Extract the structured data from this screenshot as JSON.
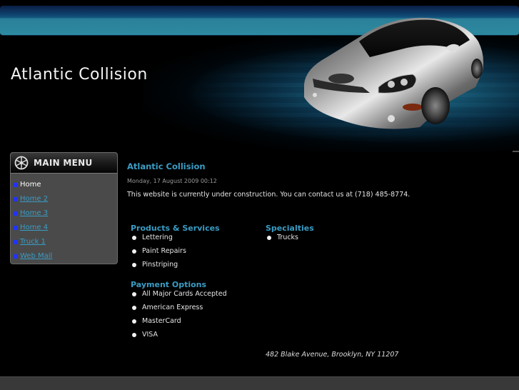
{
  "header": {
    "site_title": "Atlantic Collision",
    "banner_image": "silver-sports-car"
  },
  "menu": {
    "title": "MAIN MENU",
    "icon": "wheel-icon",
    "items": [
      {
        "label": "Home",
        "current": true
      },
      {
        "label": "Home 2",
        "current": false
      },
      {
        "label": "Home 3",
        "current": false
      },
      {
        "label": "Home 4",
        "current": false
      },
      {
        "label": "Truck 1",
        "current": false
      },
      {
        "label": "Web Mail",
        "current": false
      }
    ]
  },
  "article": {
    "title": "Atlantic Collision",
    "date": "Monday, 17 August 2009 00:12",
    "body": "This website is currently under construction. You can contact us at (718) 485-8774."
  },
  "sections": {
    "products": {
      "heading": "Products & Services",
      "items": [
        "Lettering",
        "Paint Repairs",
        "Pinstriping"
      ]
    },
    "specialties": {
      "heading": "Specialties",
      "items": [
        "Trucks"
      ]
    },
    "payment": {
      "heading": "Payment Options",
      "items": [
        "All Major Cards Accepted",
        "American Express",
        "MasterCard",
        "VISA"
      ]
    }
  },
  "address": "482 Blake Avenue, Brooklyn, NY 11207",
  "colors": {
    "accent": "#3a9cc4",
    "menu_bullet": "#2233ff",
    "background": "#000000",
    "menu_bg": "#4a4a4a",
    "footer_bg": "#393939"
  }
}
